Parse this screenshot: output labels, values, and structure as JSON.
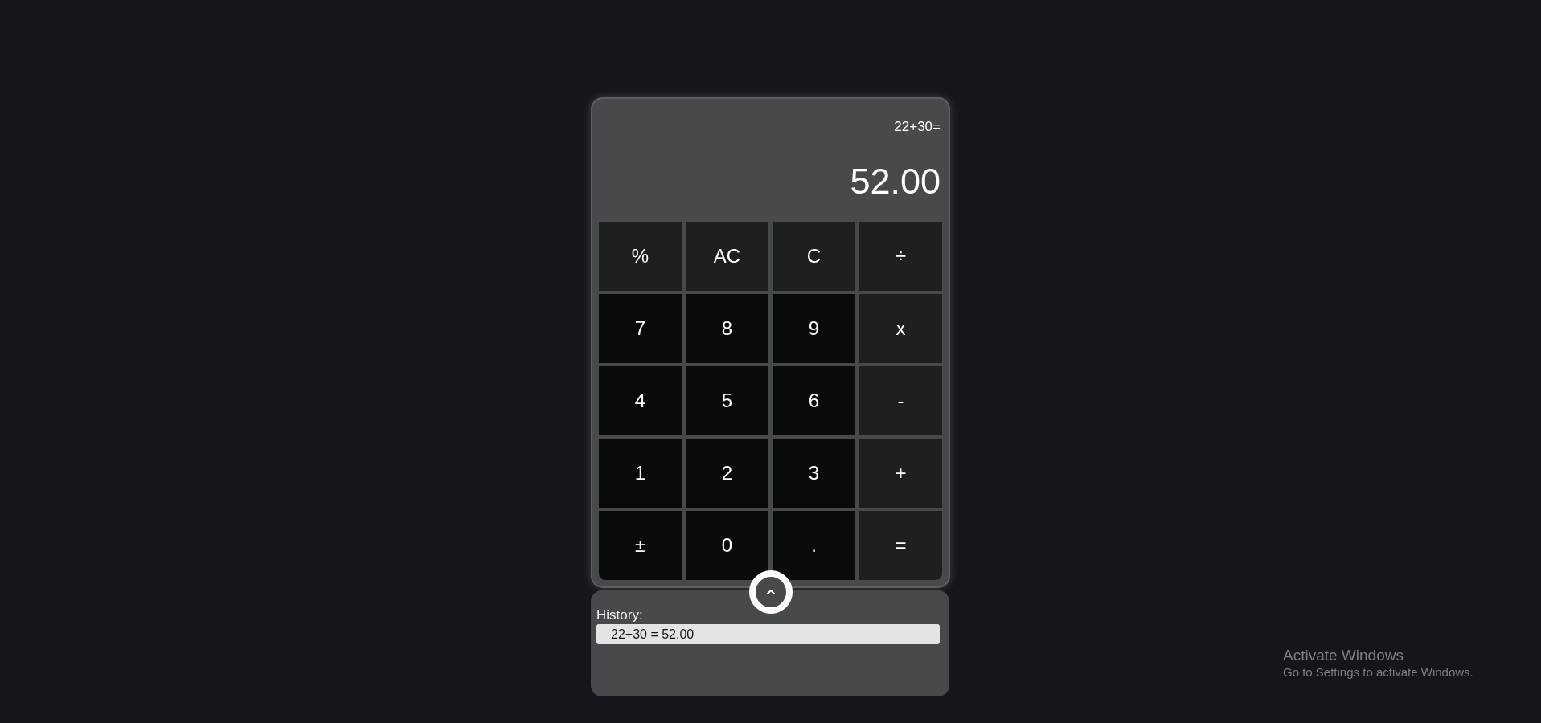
{
  "calculator": {
    "expression": "22+30=",
    "display": "52.00",
    "keys": [
      {
        "label": "%",
        "kind": "operator"
      },
      {
        "label": "AC",
        "kind": "operator"
      },
      {
        "label": "C",
        "kind": "operator"
      },
      {
        "label": "÷",
        "kind": "operator"
      },
      {
        "label": "7",
        "kind": "number"
      },
      {
        "label": "8",
        "kind": "number"
      },
      {
        "label": "9",
        "kind": "number"
      },
      {
        "label": "x",
        "kind": "operator"
      },
      {
        "label": "4",
        "kind": "number"
      },
      {
        "label": "5",
        "kind": "number"
      },
      {
        "label": "6",
        "kind": "number"
      },
      {
        "label": "-",
        "kind": "operator"
      },
      {
        "label": "1",
        "kind": "number"
      },
      {
        "label": "2",
        "kind": "number"
      },
      {
        "label": "3",
        "kind": "number"
      },
      {
        "label": "+",
        "kind": "operator"
      },
      {
        "label": "±",
        "kind": "number"
      },
      {
        "label": "0",
        "kind": "number"
      },
      {
        "label": ".",
        "kind": "number"
      },
      {
        "label": "=",
        "kind": "operator"
      }
    ]
  },
  "history": {
    "expanded": true,
    "title": "History:",
    "entries": [
      "22+30 = 52.00"
    ]
  },
  "windows_notice": {
    "title": "Activate Windows",
    "subtitle": "Go to Settings to activate Windows."
  }
}
